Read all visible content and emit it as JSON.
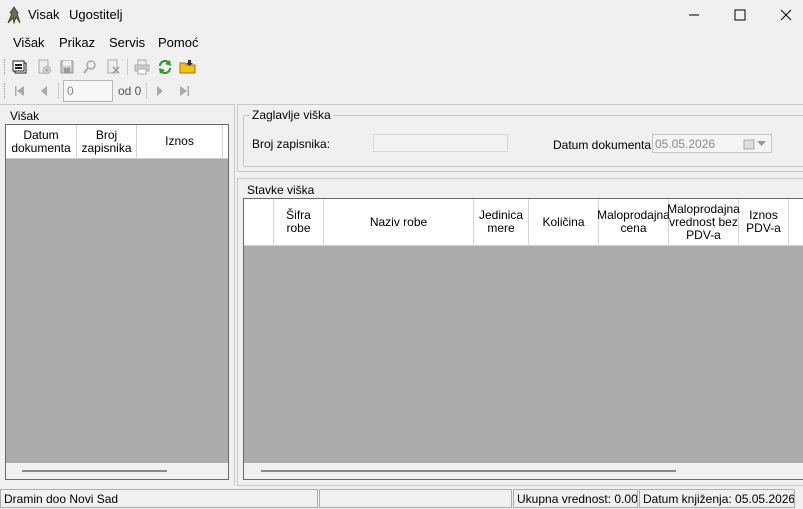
{
  "window": {
    "title": "Visak",
    "subtitle": "Ugostitelj"
  },
  "menu": [
    "Višak",
    "Prikaz",
    "Servis",
    "Pomoć"
  ],
  "toolbar_icons": [
    "new-document-icon",
    "add-icon",
    "save-icon",
    "search-icon",
    "delete-icon",
    "print-icon",
    "refresh-icon",
    "folder-icon"
  ],
  "navigator": {
    "position": "0",
    "of_label": "od 0"
  },
  "left_panel": {
    "title": "Višak",
    "columns": [
      "Datum dokumenta",
      "Broj zapisnika",
      "Iznos"
    ]
  },
  "header_group": {
    "title": "Zaglavlje viška",
    "broj_label": "Broj zapisnika:",
    "broj_value": "",
    "datum_label": "Datum dokumenta:",
    "datum_value": "05.05.2026"
  },
  "items_group": {
    "title": "Stavke viška",
    "columns": [
      "",
      "Šifra robe",
      "Naziv robe",
      "Jedinica mere",
      "Količina",
      "Maloprodajna cena",
      "Maloprodajna vrednost bez PDV-a",
      "Iznos PDV-a"
    ]
  },
  "status": {
    "company": "Dramin doo Novi Sad",
    "middle": "",
    "total": "Ukupna vrednost: 0.00",
    "posting_date": "Datum knjiženja: 05.05.2026"
  }
}
